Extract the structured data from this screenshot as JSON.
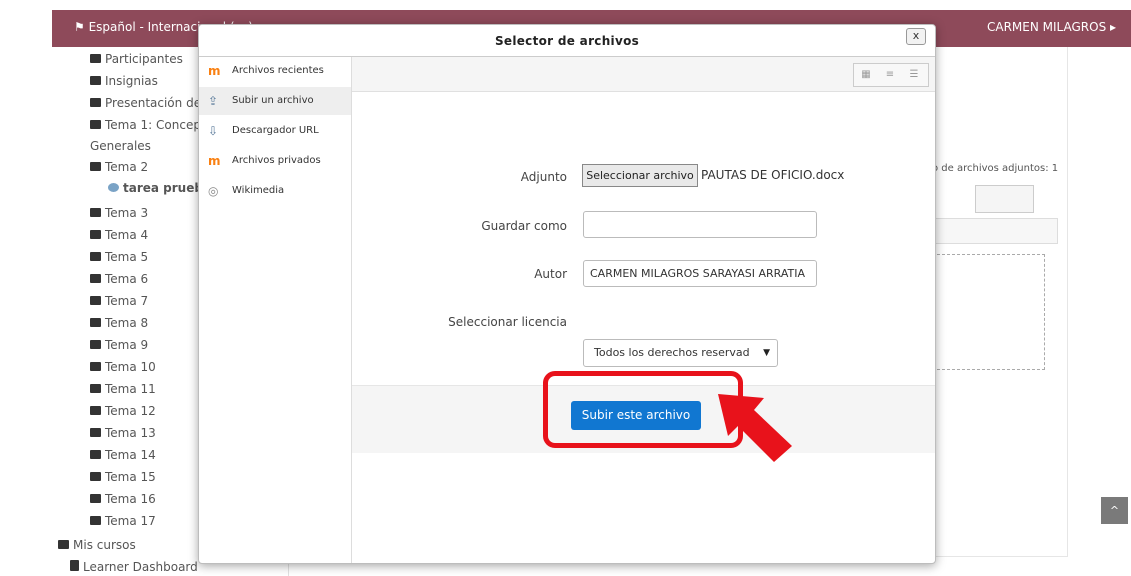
{
  "topbar": {
    "language": "Español - Internacional (es)",
    "user": "CARMEN MILAGROS"
  },
  "nav": {
    "items": [
      {
        "label": "Participantes"
      },
      {
        "label": "Insignias"
      },
      {
        "label": "Presentación de"
      },
      {
        "label": "Tema 1: Concep"
      },
      {
        "label": "Generales"
      },
      {
        "label": "Tema 2"
      },
      {
        "label": "tarea prueb"
      },
      {
        "label": "Tema 3"
      },
      {
        "label": "Tema 4"
      },
      {
        "label": "Tema 5"
      },
      {
        "label": "Tema 6"
      },
      {
        "label": "Tema 7"
      },
      {
        "label": "Tema 8"
      },
      {
        "label": "Tema 9"
      },
      {
        "label": "Tema 10"
      },
      {
        "label": "Tema 11"
      },
      {
        "label": "Tema 12"
      },
      {
        "label": "Tema 13"
      },
      {
        "label": "Tema 14"
      },
      {
        "label": "Tema 15"
      },
      {
        "label": "Tema 16"
      },
      {
        "label": "Tema 17"
      }
    ],
    "mis_cursos": "Mis cursos",
    "learner_dashboard": "Learner Dashboard"
  },
  "background": {
    "file_count": "o de archivos adjuntos: 1"
  },
  "modal": {
    "title": "Selector de archivos",
    "close": "x",
    "repositories": [
      {
        "label": "Archivos recientes",
        "icon": "moodle-icon"
      },
      {
        "label": "Subir un archivo",
        "icon": "upload-icon"
      },
      {
        "label": "Descargador URL",
        "icon": "url-download-icon"
      },
      {
        "label": "Archivos privados",
        "icon": "moodle-icon"
      },
      {
        "label": "Wikimedia",
        "icon": "wikimedia-icon"
      }
    ],
    "form": {
      "adjunto_label": "Adjunto",
      "file_button": "Seleccionar archivo",
      "file_name": "PAUTAS DE OFICIO.docx",
      "guardar_label": "Guardar como",
      "guardar_value": "",
      "autor_label": "Autor",
      "autor_value": "CARMEN MILAGROS SARAYASI ARRATIA",
      "licencia_label": "Seleccionar licencia",
      "licencia_value": "Todos los derechos reservad"
    },
    "submit_label": "Subir este archivo"
  },
  "colors": {
    "header": "#8e4a5a",
    "primary": "#1177d1",
    "highlight": "#e8121b"
  }
}
